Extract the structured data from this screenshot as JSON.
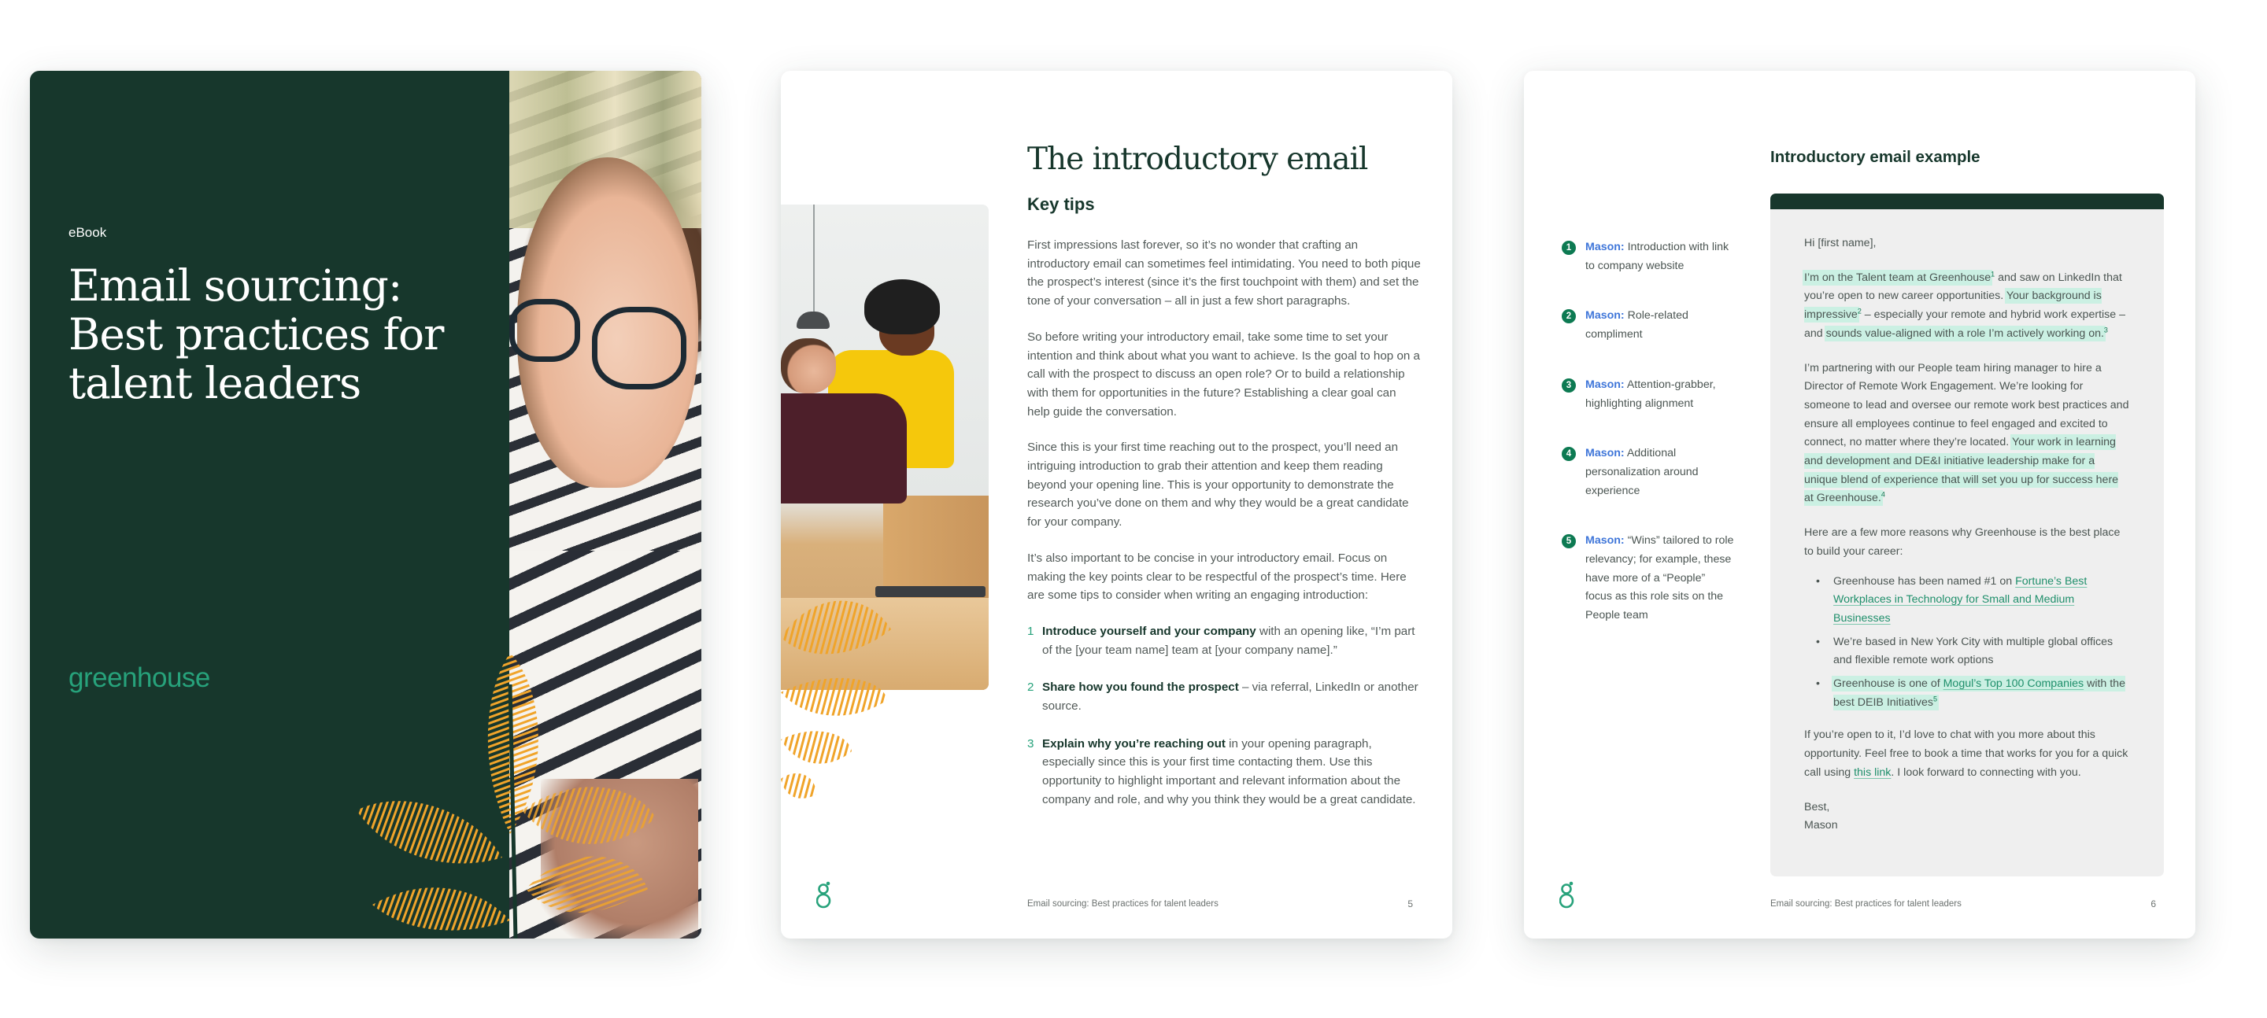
{
  "cover": {
    "label": "eBook",
    "title_lines": [
      "Email sourcing:",
      "Best practices for",
      "talent leaders"
    ],
    "logo_text": "greenhouse",
    "bg_color": "#17372c",
    "logo_color": "#27a27b",
    "accent_color": "#f0a42a"
  },
  "page5": {
    "title": "The introductory email",
    "subtitle": "Key tips",
    "paragraphs": [
      "First impressions last forever, so it’s no wonder that crafting an introductory email can sometimes feel intimidating. You need to both pique the prospect’s interest (since it’s the first touchpoint with them) and set the tone of your conversation – all in just a few short paragraphs.",
      "So before writing your introductory email, take some time to set your intention and think about what you want to achieve. Is the goal to hop on a call with the prospect to discuss an open role? Or to build a relationship with them for opportunities in the future? Establishing a clear goal can help guide the conversation.",
      "Since this is your first time reaching out to the prospect, you’ll need an intriguing introduction to grab their attention and keep them reading beyond your opening line. This is your opportunity to demonstrate the research you’ve done on them and why they would be a great candidate for your company.",
      "It’s also important to be concise in your introductory email. Focus on making the key points clear to be respectful of the prospect’s time. Here are some tips to consider when writing an engaging introduction:"
    ],
    "tips": [
      {
        "num": "1",
        "bold": "Introduce yourself and your company",
        "rest": " with an opening like, “I’m part of the [your team name] team at [your company name].”"
      },
      {
        "num": "2",
        "bold": "Share how you found the prospect",
        "rest": " – via referral, LinkedIn or another source."
      },
      {
        "num": "3",
        "bold": "Explain why you’re reaching out",
        "rest": " in your opening paragraph, especially since this is your first time contacting them. Use this opportunity to highlight important and relevant information about the company and role, and why you think they would be a great candidate."
      }
    ],
    "footer_text": "Email sourcing: Best practices for talent leaders",
    "page_number": "5"
  },
  "page6": {
    "title": "Introductory email example",
    "annotations": [
      {
        "num": "1",
        "who": "Mason:",
        "text": " Introduction with link to company website"
      },
      {
        "num": "2",
        "who": "Mason:",
        "text": " Role-related compliment"
      },
      {
        "num": "3",
        "who": "Mason:",
        "text": " Attention-grabber, highlighting alignment"
      },
      {
        "num": "4",
        "who": "Mason:",
        "text": " Additional personalization around experience"
      },
      {
        "num": "5",
        "who": "Mason:",
        "text": " “Wins” tailored to role relevancy; for example, these have more of a “People” focus as this role sits on the People team"
      }
    ],
    "email": {
      "greeting": "Hi [first name],",
      "p1": {
        "h1": "I’m on the Talent team at Greenhouse",
        "s1": "1",
        "t1": " and saw on LinkedIn that you’re open to new career opportunities. ",
        "h2": "Your background is impressive",
        "s2": "2",
        "t2": " – especially your remote and hybrid work expertise – and ",
        "h3": "sounds value-aligned with a role I’m actively working on.",
        "s3": "3"
      },
      "p2": {
        "t1": "I’m partnering with our People team hiring manager to hire a Director of Remote Work Engagement. We’re looking for someone to lead and oversee our remote work best practices and ensure all employees continue to feel engaged and excited to connect, no matter where they’re located. ",
        "h1": "Your work in learning and development and DE&I initiative leadership make for a unique blend of experience that will set you up for success here at Greenhouse.",
        "s1": "4"
      },
      "p3": "Here are a few more reasons why Greenhouse is the best place to build your career:",
      "bullets": {
        "b1_text": "Greenhouse has been named #1 on ",
        "b1_link": "Fortune’s Best Workplaces in Technology for Small and Medium Businesses",
        "b2_text": "We’re based in New York City with multiple global offices and flexible remote work options",
        "b3_text": "Greenhouse is one of ",
        "b3_link": "Mogul’s Top 100 Companies",
        "b3_rest": " with the best DEIB Initiatives",
        "b3_sup": "5"
      },
      "p4": {
        "t1": "If you’re open to it, I’d love to chat with you more about this opportunity. Feel free to book a time that works for you for a quick call using ",
        "link": "this link",
        "t2": ". I look forward to connecting with you."
      },
      "closing": "Best,",
      "signature": "Mason"
    },
    "footer_text": "Email sourcing: Best practices for talent leaders",
    "page_number": "6"
  }
}
